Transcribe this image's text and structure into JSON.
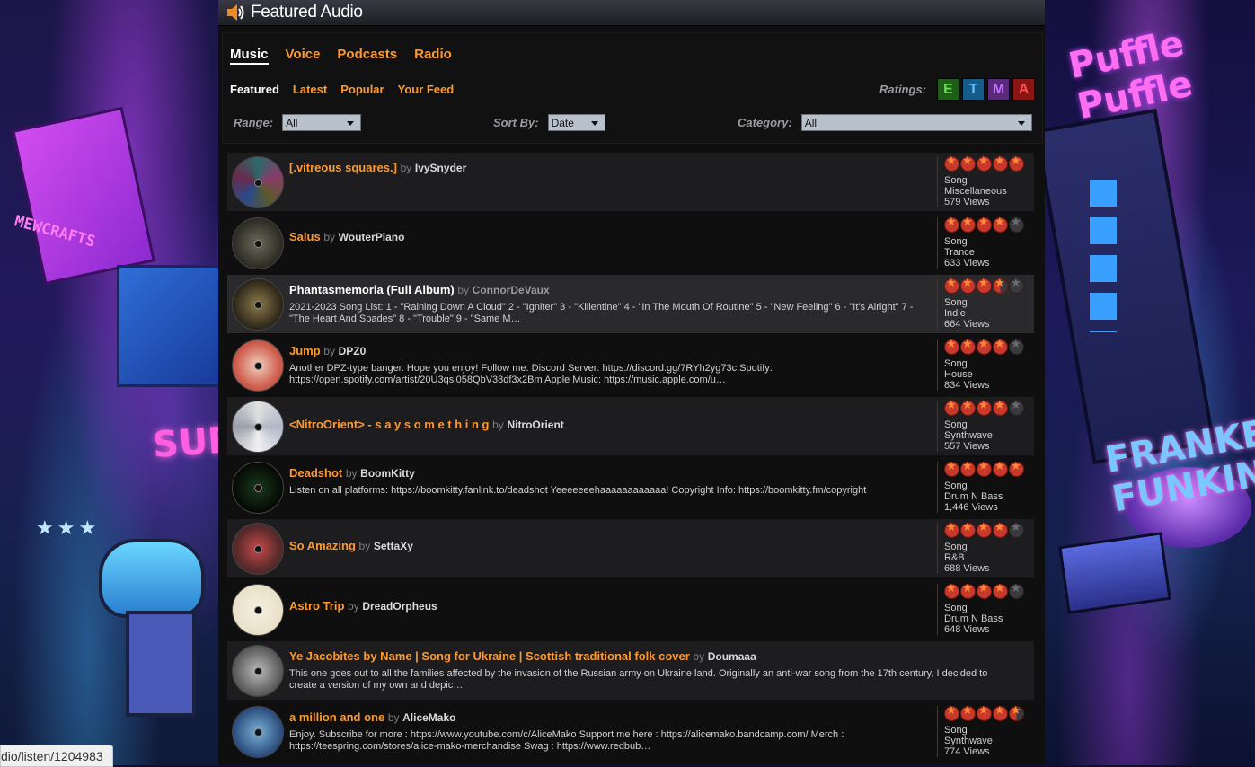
{
  "window": {
    "title": "Featured Audio",
    "speaker_icon": "speaker-icon"
  },
  "tabs_main": [
    {
      "label": "Music",
      "active": true
    },
    {
      "label": "Voice",
      "active": false
    },
    {
      "label": "Podcasts",
      "active": false
    },
    {
      "label": "Radio",
      "active": false
    }
  ],
  "tabs_sub": [
    {
      "label": "Featured",
      "active": true
    },
    {
      "label": "Latest",
      "active": false
    },
    {
      "label": "Popular",
      "active": false
    },
    {
      "label": "Your Feed",
      "active": false
    }
  ],
  "ratings": {
    "label": "Ratings:",
    "boxes": [
      "E",
      "T",
      "M",
      "A"
    ]
  },
  "filters": {
    "range": {
      "label": "Range:",
      "value": "All"
    },
    "sort": {
      "label": "Sort By:",
      "value": "Date"
    },
    "category": {
      "label": "Category:",
      "value": "All"
    }
  },
  "items": [
    {
      "title": "[.vitreous squares.]",
      "by": "by",
      "user": "IvySnyder",
      "desc": "",
      "stars": 5,
      "type": "Song",
      "genre": "Miscellaneous",
      "views": "579 Views"
    },
    {
      "title": "Salus",
      "by": "by",
      "user": "WouterPiano",
      "desc": "",
      "stars": 4,
      "type": "Song",
      "genre": "Trance",
      "views": "633 Views"
    },
    {
      "title": "Phantasmemoria (Full Album)",
      "by": "by",
      "user": "ConnorDeVaux",
      "desc": "2021-2023 Song List: 1 - \"Raining Down A Cloud\" 2 - \"Igniter\" 3 - \"Killentine\" 4 - \"In The Mouth Of Routine\" 5 - \"New Feeling\" 6 - \"It's Alright\" 7 - \"The Heart And Spades\" 8 - \"Trouble\" 9 - \"Same M…",
      "stars": 3.5,
      "type": "Song",
      "genre": "Indie",
      "views": "664 Views"
    },
    {
      "title": "Jump",
      "by": "by",
      "user": "DPZ0",
      "desc": "Another DPZ-type banger. Hope you enjoy! Follow me: Discord Server: https://discord.gg/7RYh2yg73c Spotify: https://open.spotify.com/artist/20U3qsi058QbV38df3x2Bm Apple Music: https://music.apple.com/u…",
      "stars": 4,
      "type": "Song",
      "genre": "House",
      "views": "834 Views"
    },
    {
      "title": "<NitroOrient> - s a y   s o m e t h i n g",
      "by": "by",
      "user": "NitroOrient",
      "desc": "",
      "stars": 4,
      "type": "Song",
      "genre": "Synthwave",
      "views": "557 Views"
    },
    {
      "title": "Deadshot",
      "by": "by",
      "user": "BoomKitty",
      "desc": "Listen on all platforms: https://boomkitty.fanlink.to/deadshot Yeeeeeeehaaaaaaaaaaaa! Copyright Info: https://boomkitty.fm/copyright",
      "stars": 5,
      "type": "Song",
      "genre": "Drum N Bass",
      "views": "1,446 Views"
    },
    {
      "title": "So Amazing",
      "by": "by",
      "user": "SettaXy",
      "desc": "",
      "stars": 4,
      "type": "Song",
      "genre": "R&B",
      "views": "688 Views"
    },
    {
      "title": "Astro Trip",
      "by": "by",
      "user": "DreadOrpheus",
      "desc": "",
      "stars": 4,
      "type": "Song",
      "genre": "Drum N Bass",
      "views": "648 Views"
    },
    {
      "title": "Ye Jacobites by Name | Song for Ukraine | Scottish traditional folk cover",
      "by": "by",
      "user": "Doumaaa",
      "desc": "This one goes out to all the families affected by the invasion of the Russian army on Ukraine land. Originally an anti-war song from the 17th century, I decided to create a version of my own and depic…",
      "stars": 0,
      "type": "",
      "genre": "",
      "views": ""
    },
    {
      "title": "a million and one",
      "by": "by",
      "user": "AliceMako",
      "desc": "Enjoy. Subscribe for more : https://www.youtube.com/c/AliceMako Support me here : https://alicemako.bandcamp.com/ Merch : https://teespring.com/stores/alice-mako-merchandise Swag : https://www.redbub…",
      "stars": 4.5,
      "type": "Song",
      "genre": "Synthwave",
      "views": "774 Views"
    }
  ],
  "status": {
    "url": "dio/listen/1204983"
  },
  "art": {
    "sub_sign": "SUB",
    "left_sign": "MEWCRAFTS",
    "right_title": "Puffle Puffle",
    "right_logo": "FRANKENT FUNKIN"
  }
}
